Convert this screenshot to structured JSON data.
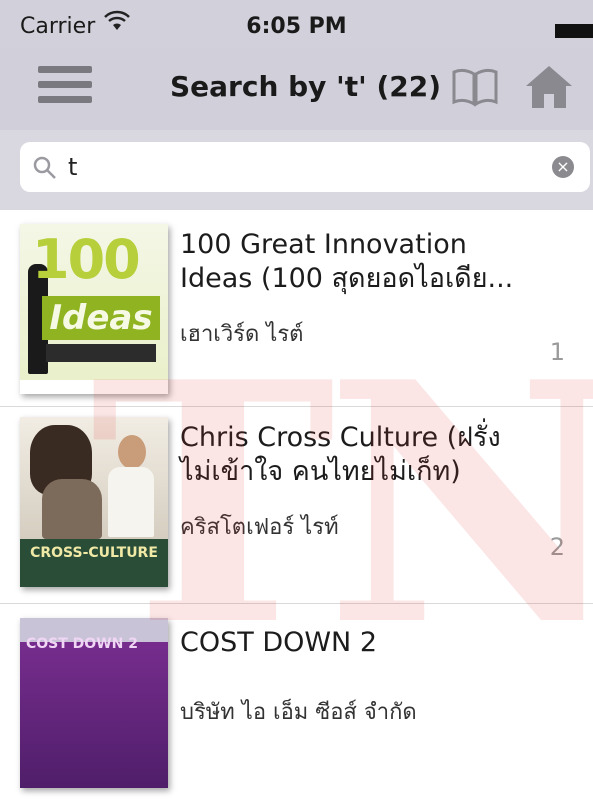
{
  "status_bar": {
    "carrier": "Carrier",
    "time": "6:05 PM"
  },
  "nav": {
    "title": "Search by 't' (22)",
    "icons": [
      "menu-icon",
      "book-icon",
      "home-icon"
    ]
  },
  "search": {
    "value": "t"
  },
  "results": [
    {
      "title_line1": "100 Great Innovation",
      "title_line2": "Ideas (100 สุดยอดไอเดีย...",
      "author": "เฮาเวิร์ด ไรต์",
      "number": "1",
      "cover_text_big": "100",
      "cover_text_ideas": "Ideas"
    },
    {
      "title_line1": "Chris Cross Culture (ฝรั่ง",
      "title_line2": "ไม่เข้าใจ คนไทยไม่เก็ท)",
      "author": "คริสโตเฟอร์ ไรท์",
      "number": "2",
      "cover_text": "CROSS-CULTURE"
    },
    {
      "title_line1": "COST DOWN 2",
      "author": "บริษัท ไอ เอ็ม ซีอส์ จำกัด",
      "cover_text": "COST DOWN 2"
    }
  ],
  "watermark": "TNI",
  "colors": {
    "nav_background": "#d0cfda",
    "search_background": "#d9d8e0",
    "watermark": "#dc2828"
  }
}
